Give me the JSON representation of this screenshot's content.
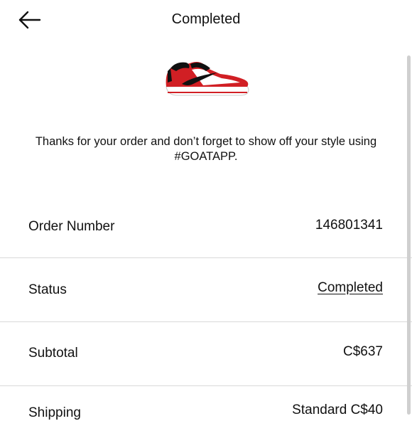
{
  "header": {
    "title": "Completed",
    "back_icon": "arrow-left-icon"
  },
  "product": {
    "image_icon": "sneaker-image",
    "colors": {
      "red": "#d11f24",
      "black": "#111111",
      "white": "#ffffff"
    }
  },
  "message": "Thanks for your order and don’t forget to show off your style using #GOATAPP.",
  "order": {
    "number_label": "Order Number",
    "number_value": "146801341",
    "status_label": "Status",
    "status_value": "Completed",
    "subtotal_label": "Subtotal",
    "subtotal_value": "C$637",
    "shipping_label": "Shipping",
    "shipping_value": "Standard C$40"
  }
}
